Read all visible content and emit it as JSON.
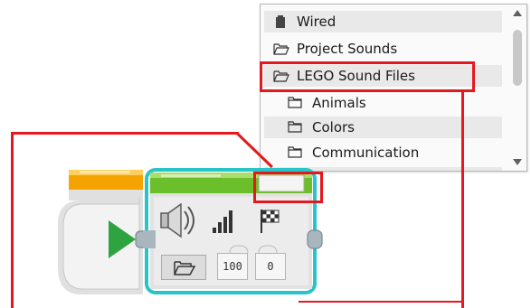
{
  "dropdown": {
    "items": [
      {
        "label": "Wired",
        "icon": "battery-icon"
      },
      {
        "label": "Project Sounds",
        "icon": "open-folder-icon"
      },
      {
        "label": "LEGO Sound Files",
        "icon": "open-folder-icon"
      },
      {
        "label": "Animals",
        "icon": "folder-icon"
      },
      {
        "label": "Colors",
        "icon": "folder-icon"
      },
      {
        "label": "Communication",
        "icon": "folder-icon"
      }
    ]
  },
  "sound_block": {
    "volume_value": "100",
    "play_type_value": "0"
  },
  "colors": {
    "accent_red": "#e4191f",
    "start_header": "#f5a300",
    "sound_header": "#6bbf2a",
    "selection_glow": "#27c4c8",
    "play_green": "#2ea340"
  }
}
